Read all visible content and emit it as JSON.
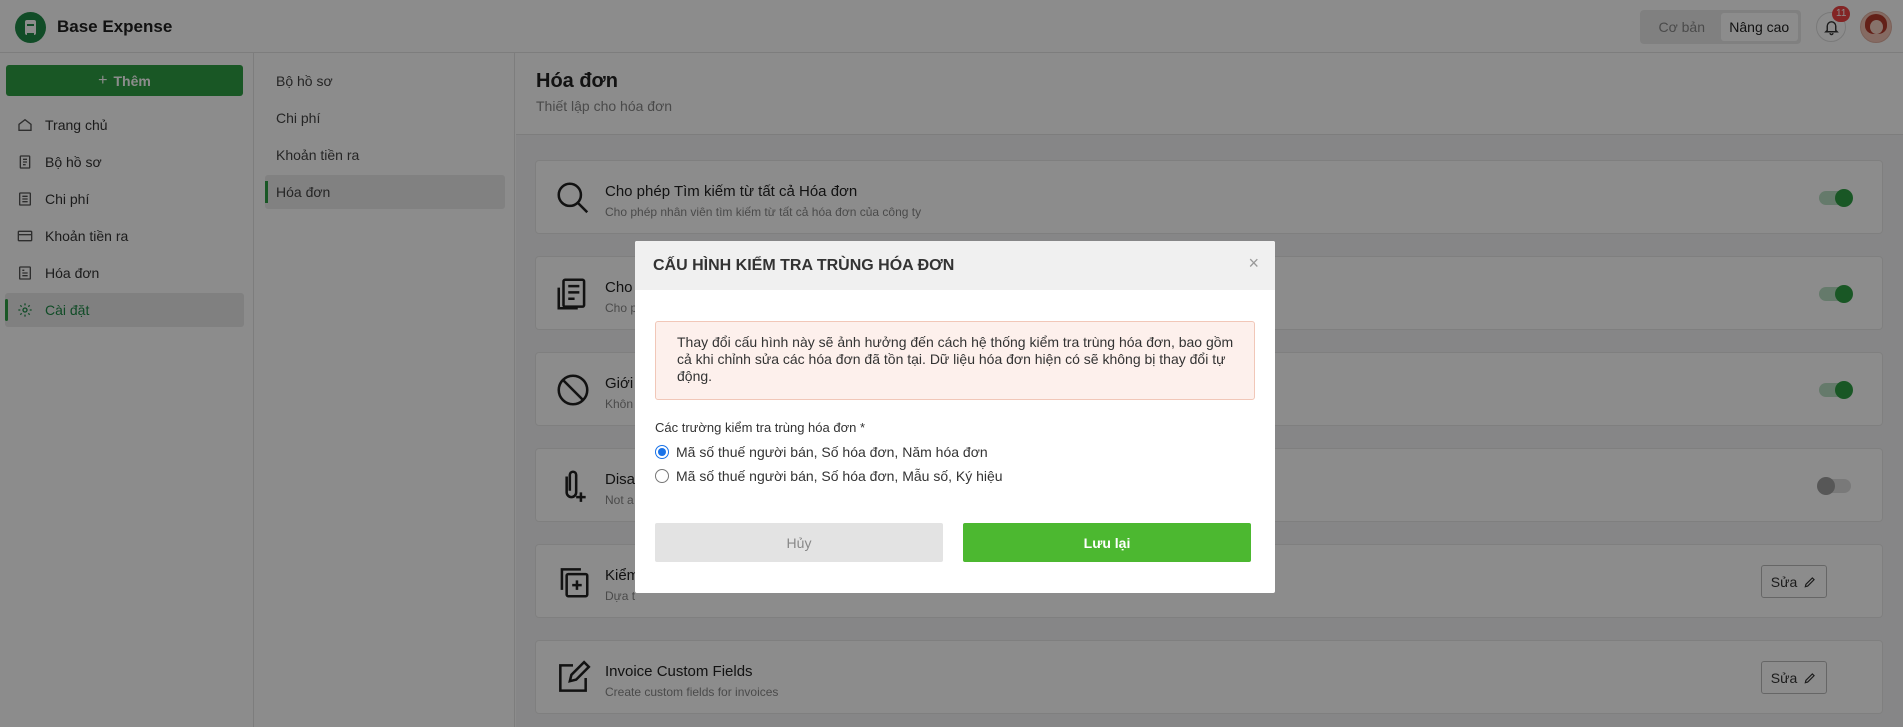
{
  "app": {
    "title": "Base Expense"
  },
  "header": {
    "mode_basic": "Cơ bản",
    "mode_advanced": "Nâng cao",
    "notification_count": "11"
  },
  "sidebar": {
    "add_label": "Thêm",
    "items": [
      {
        "label": "Trang chủ",
        "icon": "home-icon"
      },
      {
        "label": "Bộ hồ sơ",
        "icon": "folder-doc-icon"
      },
      {
        "label": "Chi phí",
        "icon": "list-icon"
      },
      {
        "label": "Khoản tiền ra",
        "icon": "card-icon"
      },
      {
        "label": "Hóa đơn",
        "icon": "invoice-icon"
      },
      {
        "label": "Cài đặt",
        "icon": "gear-icon",
        "active": true
      }
    ]
  },
  "subnav": {
    "items": [
      {
        "label": "Bộ hồ sơ"
      },
      {
        "label": "Chi phí"
      },
      {
        "label": "Khoản tiền ra"
      },
      {
        "label": "Hóa đơn",
        "active": true
      }
    ]
  },
  "main": {
    "title": "Hóa đơn",
    "subtitle": "Thiết lập cho hóa đơn",
    "cards": [
      {
        "title": "Cho phép Tìm kiếm từ tất cả Hóa đơn",
        "desc": "Cho phép nhân viên tìm kiếm từ tất cả hóa đơn của công ty",
        "control": "toggle",
        "on": true,
        "icon": "search-icon"
      },
      {
        "title": "Cho",
        "desc": "Cho p",
        "control": "toggle",
        "on": true,
        "icon": "receipt-icon"
      },
      {
        "title": "Giới",
        "desc": "Khôn",
        "control": "toggle",
        "on": true,
        "icon": "block-icon"
      },
      {
        "title": "Disa",
        "desc": "Not a",
        "control": "toggle",
        "on": false,
        "icon": "attach-icon"
      },
      {
        "title": "Kiểm",
        "desc": "Dựa t",
        "control": "edit",
        "icon": "copy-plus-icon"
      },
      {
        "title": "Invoice Custom Fields",
        "desc": "Create custom fields for invoices",
        "control": "edit",
        "icon": "edit-icon"
      }
    ],
    "edit_label": "Sửa"
  },
  "modal": {
    "title": "CẤU HÌNH KIỂM TRA TRÙNG HÓA ĐƠN",
    "close": "×",
    "alert": "Thay đổi cấu hình này sẽ ảnh hưởng đến cách hệ thống kiểm tra trùng hóa đơn, bao gồm cả khi chỉnh sửa các hóa đơn đã tồn tại. Dữ liệu hóa đơn hiện có sẽ không bị thay đổi tự động.",
    "field_label": "Các trường kiểm tra trùng hóa đơn *",
    "options": [
      {
        "label": "Mã số thuế người bán, Số hóa đơn, Năm hóa đơn",
        "checked": true
      },
      {
        "label": "Mã số thuế người bán, Số hóa đơn, Mẫu số, Ký hiệu",
        "checked": false
      }
    ],
    "cancel_label": "Hủy",
    "save_label": "Lưu lại"
  },
  "colors": {
    "brand": "#2f9e44",
    "save": "#4cb830",
    "alert_bg": "#fdf0ec"
  }
}
